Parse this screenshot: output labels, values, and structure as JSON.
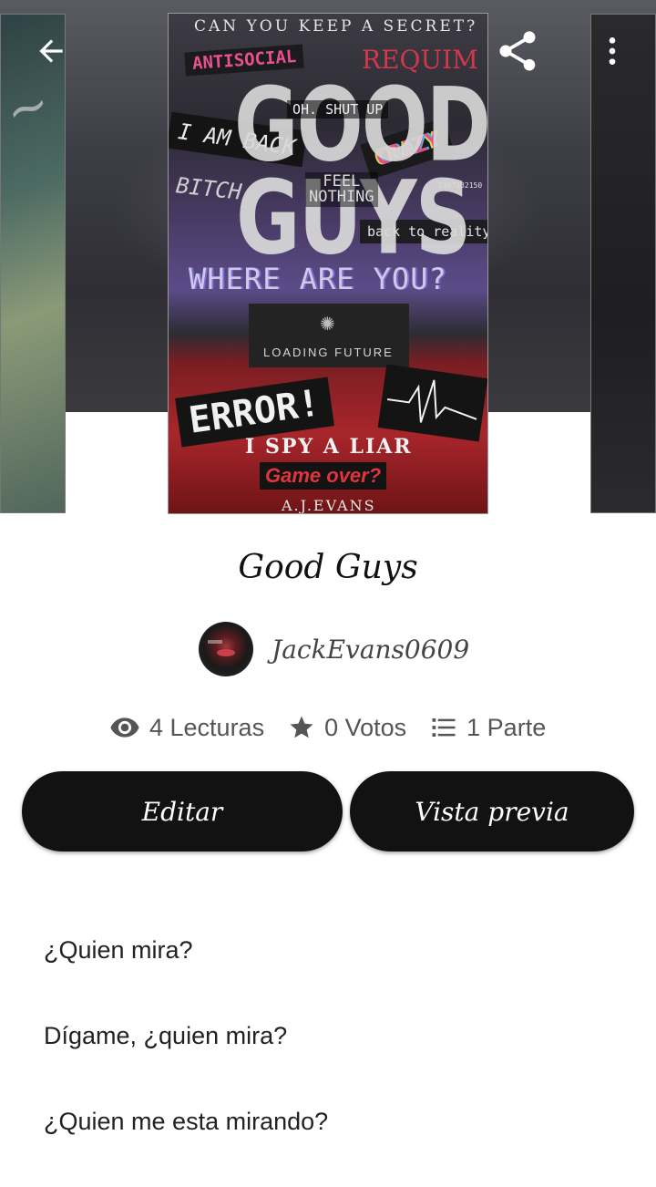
{
  "cover": {
    "tagline": "CAN YOU KEEP A SECRET?",
    "stickers": {
      "antisocial": "ANTISOCIAL",
      "requiem": "REQUIM",
      "title_line1": "GOOD",
      "title_line2": "GUYS",
      "oh_shut_up": "OH. SHUT UP",
      "i_am_back": "I AM BACK",
      "crazy": "CRAZY",
      "feel": "FEEL",
      "nothing": "NOTHING",
      "bitch": "BITCH",
      "code": "8307432150",
      "back_to_reality": "back to reality.",
      "where_are_you": "WHERE ARE YOU?",
      "loading_future": "LOADING FUTURE",
      "error": "ERROR!",
      "i_spy_a_liar": "I SPY A LIAR",
      "game_over": "Game over?",
      "author_credit": "A.J.EVANS"
    }
  },
  "story": {
    "title": "Good Guys",
    "author": "JackEvans0609",
    "stats": {
      "reads": "4 Lecturas",
      "votes": "0 Votos",
      "parts": "1 Parte"
    }
  },
  "actions": {
    "edit_label": "Editar",
    "preview_label": "Vista previa"
  },
  "description": [
    "¿Quien mira?",
    "Dígame, ¿quien mira?",
    "¿Quien me esta mirando?"
  ],
  "icons": {
    "back": "arrow-left-icon",
    "share": "share-icon",
    "more": "more-vertical-icon",
    "reads": "eye-icon",
    "votes": "star-icon",
    "parts": "list-icon"
  },
  "colors": {
    "button_bg": "#121212",
    "button_text": "#ffffff",
    "stats_text": "#555555"
  }
}
